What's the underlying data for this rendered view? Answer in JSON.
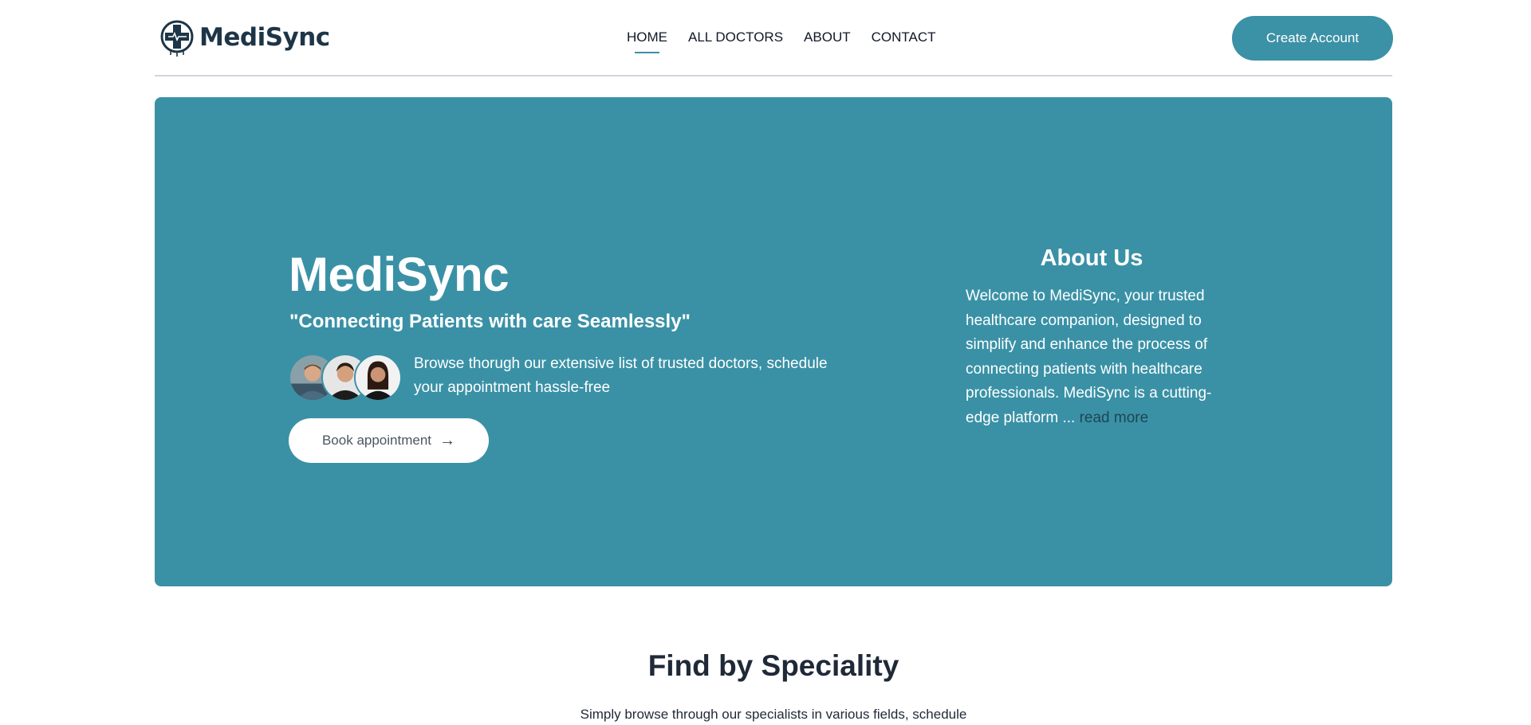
{
  "brand": {
    "name": "MediSync",
    "accent_color": "#3b91a6",
    "dark_color": "#1d3547"
  },
  "nav": {
    "items": [
      {
        "label": "HOME",
        "active": true
      },
      {
        "label": "ALL DOCTORS",
        "active": false
      },
      {
        "label": "ABOUT",
        "active": false
      },
      {
        "label": "CONTACT",
        "active": false
      }
    ]
  },
  "header": {
    "create_account_label": "Create Account"
  },
  "hero": {
    "title": "MediSync",
    "tagline": "\"Connecting Patients with care Seamlessly\"",
    "description": "Browse thorugh our extensive list of trusted doctors, schedule your appointment hassle-free",
    "book_label": "Book appointment",
    "book_icon": "arrow-right-icon",
    "background_color": "#3a91a6"
  },
  "about": {
    "heading": "About Us",
    "text": "Welcome to MediSync, your trusted healthcare companion, designed to simplify and enhance the process of connecting patients with healthcare professionals. MediSync is a cutting-edge platform ... ",
    "read_more_label": "read more"
  },
  "speciality": {
    "heading": "Find by Speciality",
    "subtitle": "Simply browse through our specialists in various fields, schedule"
  }
}
